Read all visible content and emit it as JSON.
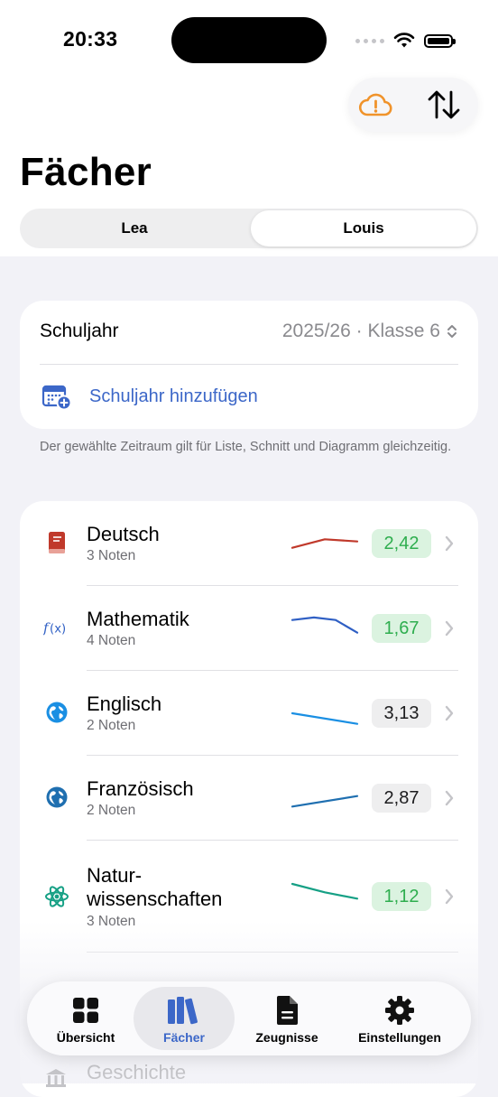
{
  "status_bar": {
    "time": "20:33"
  },
  "page": {
    "title": "Fächer"
  },
  "segmented": {
    "options": [
      "Lea",
      "Louis"
    ],
    "selected": "Louis"
  },
  "school_year": {
    "label": "Schuljahr",
    "value": "2025/26 · Klasse 6",
    "add_label": "Schuljahr hinzufügen",
    "footnote": "Der gewählte Zeitraum gilt für Liste, Schnitt und Diagramm gleichzeitig."
  },
  "subjects": [
    {
      "name": "Deutsch",
      "count": "3 Noten",
      "average": "2,42",
      "icon": "book-icon",
      "color": "#c0392b",
      "trend": [
        3.0,
        2.0,
        2.25
      ],
      "badge": "good"
    },
    {
      "name": "Mathematik",
      "count": "4 Noten",
      "average": "1,67",
      "icon": "function-icon",
      "color": "#2f5fc4",
      "trend": [
        1.5,
        1.2,
        1.5,
        3.0
      ],
      "badge": "good"
    },
    {
      "name": "Englisch",
      "count": "2 Noten",
      "average": "3,13",
      "icon": "globe-icon",
      "color": "#1a8fe3",
      "trend": [
        2.5,
        3.75
      ],
      "badge": "neutral"
    },
    {
      "name": "Französisch",
      "count": "2 Noten",
      "average": "2,87",
      "icon": "globe-icon",
      "color": "#1f6fb0",
      "trend": [
        3.5,
        2.25
      ],
      "badge": "neutral"
    },
    {
      "name": "Natur-\nwissenschaften",
      "count": "3 Noten",
      "average": "1,12",
      "icon": "atom-icon",
      "color": "#16a085",
      "trend": [
        1.0,
        2.0,
        2.75
      ],
      "badge": "good"
    },
    {
      "name": "Geschichte",
      "icon": "building-icon",
      "partial": true
    }
  ],
  "tabbar": {
    "items": [
      {
        "label": "Übersicht",
        "icon": "grid-icon"
      },
      {
        "label": "Fächer",
        "icon": "books-icon",
        "active": true
      },
      {
        "label": "Zeugnisse",
        "icon": "document-icon"
      },
      {
        "label": "Einstellungen",
        "icon": "gear-icon"
      }
    ]
  },
  "colors": {
    "accent": "#3c67c8",
    "cloud_warning": "#f0932b",
    "good_badge_bg": "#dbf3e0",
    "good_badge_text": "#2fae4f"
  }
}
